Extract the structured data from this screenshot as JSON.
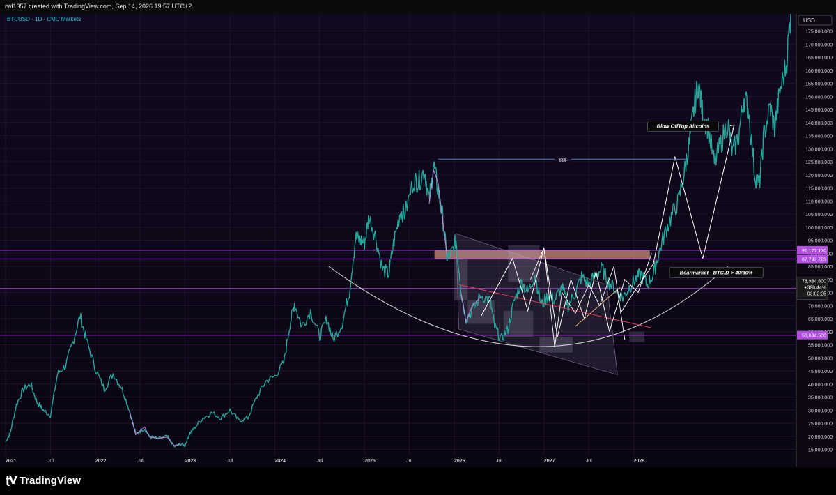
{
  "header": {
    "attribution": "rwl1357 created with TradingView.com, Sep 14, 2026 19:57 UTC+2"
  },
  "brand": {
    "name": "TradingView",
    "icon": "tradingview-logo-icon"
  },
  "chart_data": {
    "type": "line",
    "symbol_label": "BTCUSD · 1D · CMC Markets",
    "currency": "USD",
    "ylim": [
      13000,
      181000
    ],
    "xlim": [
      2021.0,
      2029.75
    ],
    "y_ticks": [
      15000,
      20000,
      25000,
      30000,
      35000,
      40000,
      45000,
      50000,
      55000,
      60000,
      65000,
      70000,
      75000,
      80000,
      85000,
      90000,
      95000,
      100000,
      105000,
      110000,
      115000,
      120000,
      125000,
      130000,
      135000,
      140000,
      145000,
      150000,
      155000,
      160000,
      165000,
      170000,
      175000
    ],
    "x_ticks": [
      {
        "t": 2021.0,
        "label": "2021"
      },
      {
        "t": 2021.5,
        "label": "Jul"
      },
      {
        "t": 2022.0,
        "label": "2022"
      },
      {
        "t": 2022.5,
        "label": "Jul"
      },
      {
        "t": 2023.0,
        "label": "2023"
      },
      {
        "t": 2023.5,
        "label": "Jul"
      },
      {
        "t": 2024.0,
        "label": "2024"
      },
      {
        "t": 2024.5,
        "label": "Jul"
      },
      {
        "t": 2025.0,
        "label": "2025"
      },
      {
        "t": 2025.5,
        "label": "Jul"
      },
      {
        "t": 2026.0,
        "label": "2026"
      },
      {
        "t": 2026.5,
        "label": "Jul"
      },
      {
        "t": 2027.0,
        "label": "2027"
      },
      {
        "t": 2027.5,
        "label": "Jul"
      },
      {
        "t": 2028.0,
        "label": "2028"
      }
    ],
    "series": [
      {
        "color": "#26a69a",
        "points": [
          [
            2021.0,
            18000
          ],
          [
            2021.05,
            21000
          ],
          [
            2021.12,
            32000
          ],
          [
            2021.2,
            38000
          ],
          [
            2021.28,
            40000
          ],
          [
            2021.35,
            33000
          ],
          [
            2021.42,
            30000
          ],
          [
            2021.5,
            28000
          ],
          [
            2021.58,
            44000
          ],
          [
            2021.67,
            47000
          ],
          [
            2021.75,
            56000
          ],
          [
            2021.83,
            66000
          ],
          [
            2021.9,
            57000
          ],
          [
            2022.0,
            46000
          ],
          [
            2022.1,
            38000
          ],
          [
            2022.2,
            44000
          ],
          [
            2022.3,
            38000
          ],
          [
            2022.38,
            30000
          ],
          [
            2022.45,
            21000
          ],
          [
            2022.55,
            23000
          ],
          [
            2022.6,
            20000
          ],
          [
            2022.7,
            19000
          ],
          [
            2022.8,
            20000
          ],
          [
            2022.88,
            16000
          ],
          [
            2022.95,
            17000
          ],
          [
            2023.0,
            16500
          ],
          [
            2023.05,
            21000
          ],
          [
            2023.1,
            23000
          ],
          [
            2023.2,
            27000
          ],
          [
            2023.3,
            29000
          ],
          [
            2023.4,
            27000
          ],
          [
            2023.5,
            30000
          ],
          [
            2023.6,
            26000
          ],
          [
            2023.7,
            27000
          ],
          [
            2023.8,
            35000
          ],
          [
            2023.9,
            41000
          ],
          [
            2024.0,
            43000
          ],
          [
            2024.1,
            48000
          ],
          [
            2024.17,
            63000
          ],
          [
            2024.22,
            71000
          ],
          [
            2024.3,
            62000
          ],
          [
            2024.4,
            68000
          ],
          [
            2024.5,
            58000
          ],
          [
            2024.58,
            65000
          ],
          [
            2024.65,
            57000
          ],
          [
            2024.75,
            63000
          ],
          [
            2024.83,
            75000
          ],
          [
            2024.9,
            96000
          ],
          [
            2024.95,
            95000
          ],
          [
            2025.0,
            94000
          ],
          [
            2025.05,
            104000
          ],
          [
            2025.12,
            97000
          ],
          [
            2025.2,
            84000
          ],
          [
            2025.27,
            82000
          ],
          [
            2025.33,
            95000
          ],
          [
            2025.4,
            106000
          ],
          [
            2025.45,
            105000
          ],
          [
            2025.55,
            118000
          ],
          [
            2025.6,
            117000
          ],
          [
            2025.67,
            122000
          ],
          [
            2025.72,
            110000
          ],
          [
            2025.77,
            124000
          ],
          [
            2025.82,
            114000
          ],
          [
            2025.87,
            104000
          ],
          [
            2025.92,
            88000
          ],
          [
            2025.97,
            90000
          ],
          [
            2026.02,
            95000
          ],
          [
            2026.08,
            75000
          ],
          [
            2026.13,
            65000
          ],
          [
            2026.2,
            68000
          ],
          [
            2026.3,
            74000
          ],
          [
            2026.4,
            72000
          ],
          [
            2026.45,
            62000
          ],
          [
            2026.52,
            57000
          ],
          [
            2026.6,
            61000
          ],
          [
            2026.67,
            72000
          ],
          [
            2026.75,
            79000
          ],
          [
            2026.82,
            75000
          ],
          [
            2026.9,
            82000
          ],
          [
            2026.97,
            70000
          ],
          [
            2027.05,
            74000
          ],
          [
            2027.12,
            72000
          ],
          [
            2027.2,
            77000
          ],
          [
            2027.27,
            70000
          ],
          [
            2027.35,
            75000
          ],
          [
            2027.42,
            81000
          ],
          [
            2027.5,
            78000
          ],
          [
            2027.58,
            82000
          ],
          [
            2027.65,
            84000
          ],
          [
            2027.72,
            79000
          ],
          [
            2027.8,
            76000
          ],
          [
            2027.88,
            73000
          ],
          [
            2027.95,
            77000
          ],
          [
            2028.02,
            80000
          ],
          [
            2028.08,
            82000
          ],
          [
            2028.15,
            78000
          ],
          [
            2028.22,
            82000
          ],
          [
            2028.28,
            90000
          ],
          [
            2028.35,
            98000
          ],
          [
            2028.42,
            104000
          ],
          [
            2028.5,
            110000
          ],
          [
            2028.57,
            122000
          ],
          [
            2028.62,
            132000
          ],
          [
            2028.67,
            145000
          ],
          [
            2028.72,
            155000
          ],
          [
            2028.77,
            143000
          ],
          [
            2028.83,
            138000
          ],
          [
            2028.9,
            124000
          ],
          [
            2028.97,
            132000
          ],
          [
            2029.05,
            140000
          ],
          [
            2029.1,
            128000
          ],
          [
            2029.17,
            135000
          ],
          [
            2029.23,
            150000
          ],
          [
            2029.28,
            145000
          ],
          [
            2029.35,
            120000
          ],
          [
            2029.4,
            116000
          ],
          [
            2029.45,
            135000
          ],
          [
            2029.52,
            146000
          ],
          [
            2029.57,
            138000
          ],
          [
            2029.63,
            152000
          ],
          [
            2029.7,
            162000
          ],
          [
            2029.75,
            182000
          ]
        ]
      }
    ],
    "price_lines": [
      {
        "value": 91177.17,
        "label": "91,177.170",
        "color": "#b65be8"
      },
      {
        "value": 87792.785,
        "label": "87,792.785",
        "color": "#b65be8"
      },
      {
        "value": 76480.225,
        "label": "76,480.225",
        "color": "#b65be8"
      },
      {
        "value": 58694.5,
        "label": "58,694.500",
        "color": "#b65be8"
      }
    ],
    "current_price": {
      "value": 78934.8,
      "label": "78,934.800",
      "change": "+328.44%",
      "countdown": "03:02:25"
    },
    "target_line": {
      "t0": 2025.82,
      "t1": 2028.6,
      "value": 126000,
      "label": "$$$"
    },
    "annotations": [
      {
        "text": "Blow OffTop Altcoins",
        "t": 2028.55,
        "y": 138500
      },
      {
        "text": "Bearmarket - BTC.D > 40/30%",
        "t": 2028.92,
        "y": 82500
      }
    ],
    "projection_path": [
      [
        2027.85,
        67000
      ],
      [
        2028.0,
        75000
      ],
      [
        2028.22,
        86000
      ],
      [
        2028.46,
        127000
      ],
      [
        2028.77,
        88000
      ],
      [
        2029.12,
        139000
      ]
    ],
    "cup_curve": {
      "t_start": 2024.6,
      "t_end": 2029.05,
      "bottom_t": 2027.05,
      "bottom_y": 53500,
      "start_y": 85000,
      "end_y": 85000
    },
    "supply_zone": {
      "t0": 2025.78,
      "t1": 2028.18,
      "y0": 87800,
      "y1": 91177
    }
  }
}
